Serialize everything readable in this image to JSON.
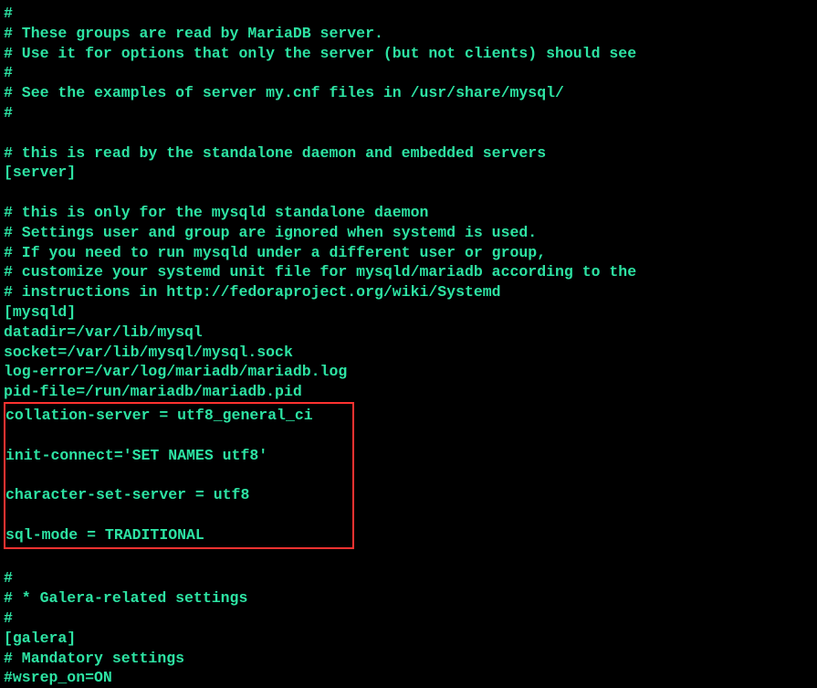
{
  "config": {
    "section1": {
      "l1": "#",
      "l2": "# These groups are read by MariaDB server.",
      "l3": "# Use it for options that only the server (but not clients) should see",
      "l4": "#",
      "l5": "# See the examples of server my.cnf files in /usr/share/mysql/",
      "l6": "#"
    },
    "section2": {
      "l1": "# this is read by the standalone daemon and embedded servers",
      "l2": "[server]"
    },
    "section3": {
      "l1": "# this is only for the mysqld standalone daemon",
      "l2": "# Settings user and group are ignored when systemd is used.",
      "l3": "# If you need to run mysqld under a different user or group,",
      "l4": "# customize your systemd unit file for mysqld/mariadb according to the",
      "l5": "# instructions in http://fedoraproject.org/wiki/Systemd",
      "l6": "[mysqld]",
      "l7": "datadir=/var/lib/mysql",
      "l8": "socket=/var/lib/mysql/mysql.sock",
      "l9": "log-error=/var/log/mariadb/mariadb.log",
      "l10": "pid-file=/run/mariadb/mariadb.pid"
    },
    "highlighted": {
      "l1": "collation-server = utf8_general_ci",
      "blank1": " ",
      "l2": "init-connect='SET NAMES utf8'",
      "blank2": " ",
      "l3": "character-set-server = utf8",
      "blank3": " ",
      "l4": "sql-mode = TRADITIONAL"
    },
    "section4": {
      "l1": "#",
      "l2": "# * Galera-related settings",
      "l3": "#",
      "l4": "[galera]",
      "l5": "# Mandatory settings",
      "l6": "#wsrep_on=ON"
    }
  }
}
